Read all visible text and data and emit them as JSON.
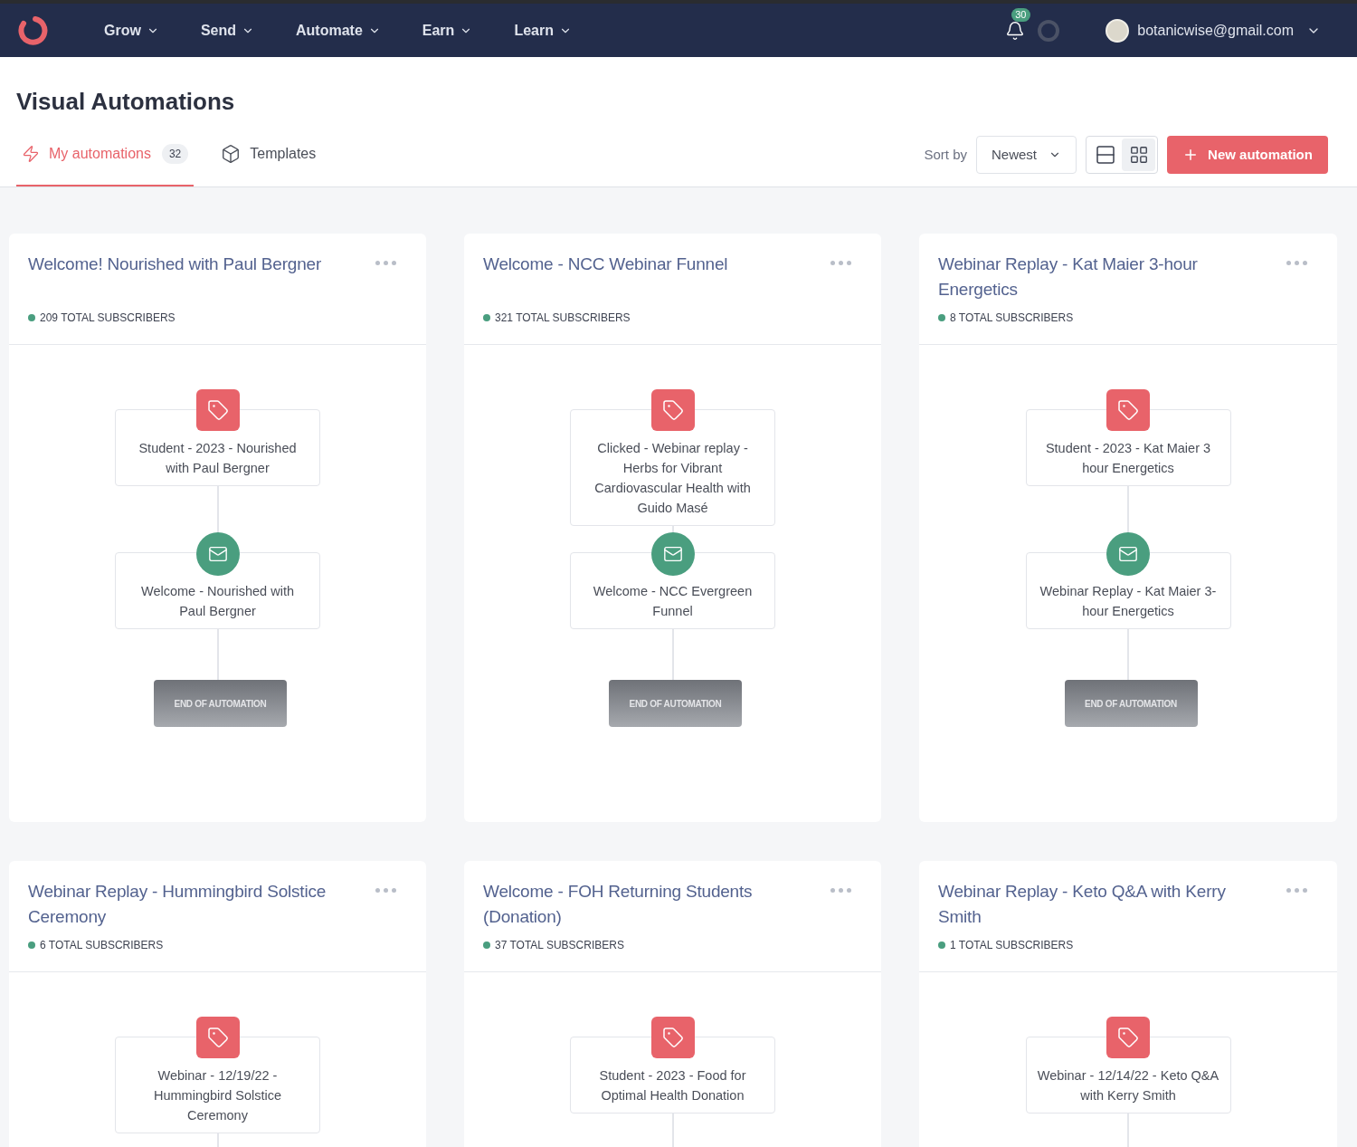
{
  "nav": {
    "items": [
      "Grow",
      "Send",
      "Automate",
      "Earn",
      "Learn"
    ],
    "notification_count": "30",
    "account_email": "botanicwise@gmail.com"
  },
  "page": {
    "title": "Visual Automations"
  },
  "tabs": [
    {
      "kind": "automations",
      "label": "My automations",
      "count": "32",
      "selected": true
    },
    {
      "kind": "templates",
      "label": "Templates",
      "selected": false
    }
  ],
  "toolbar": {
    "sort_label": "Sort by",
    "sort_value": "Newest",
    "views": [
      {
        "kind": "rows",
        "selected": false
      },
      {
        "kind": "grid",
        "selected": true
      }
    ],
    "new_button": "New automation"
  },
  "cards": [
    {
      "title": "Welcome! Nourished with Paul Bergner",
      "subscribers": "209 TOTAL SUBSCRIBERS",
      "steps": [
        {
          "kind": "tag",
          "label": "Student - 2023 - Nourished with Paul Bergner"
        },
        {
          "kind": "email",
          "label": "Welcome - Nourished with Paul Bergner"
        }
      ],
      "end": "END OF AUTOMATION"
    },
    {
      "title": "Welcome - NCC Webinar Funnel",
      "subscribers": "321 TOTAL SUBSCRIBERS",
      "steps": [
        {
          "kind": "tag",
          "label": "Clicked - Webinar replay - Herbs for Vibrant Cardiovascular Health with Guido Masé"
        },
        {
          "kind": "email",
          "label": "Welcome - NCC Evergreen Funnel"
        }
      ],
      "end": "END OF AUTOMATION"
    },
    {
      "title": "Webinar Replay - Kat Maier 3-hour Energetics",
      "subscribers": "8 TOTAL SUBSCRIBERS",
      "steps": [
        {
          "kind": "tag",
          "label": "Student - 2023 - Kat Maier 3 hour Energetics"
        },
        {
          "kind": "email",
          "label": "Webinar Replay - Kat Maier 3-hour Energetics"
        }
      ],
      "end": "END OF AUTOMATION"
    },
    {
      "title": "Webinar Replay - Hummingbird Solstice Ceremony",
      "subscribers": "6 TOTAL SUBSCRIBERS",
      "steps": [
        {
          "kind": "tag",
          "label": "Webinar - 12/19/22 - Hummingbird Solstice Ceremony"
        }
      ]
    },
    {
      "title": "Welcome - FOH Returning Students (Donation)",
      "subscribers": "37 TOTAL SUBSCRIBERS",
      "steps": [
        {
          "kind": "tag",
          "label": "Student - 2023 - Food for Optimal Health Donation"
        }
      ]
    },
    {
      "title": "Webinar Replay - Keto Q&A with Kerry Smith",
      "subscribers": "1 TOTAL SUBSCRIBERS",
      "steps": [
        {
          "kind": "tag",
          "label": "Webinar - 12/14/22 - Keto Q&A with Kerry Smith"
        }
      ]
    }
  ]
}
